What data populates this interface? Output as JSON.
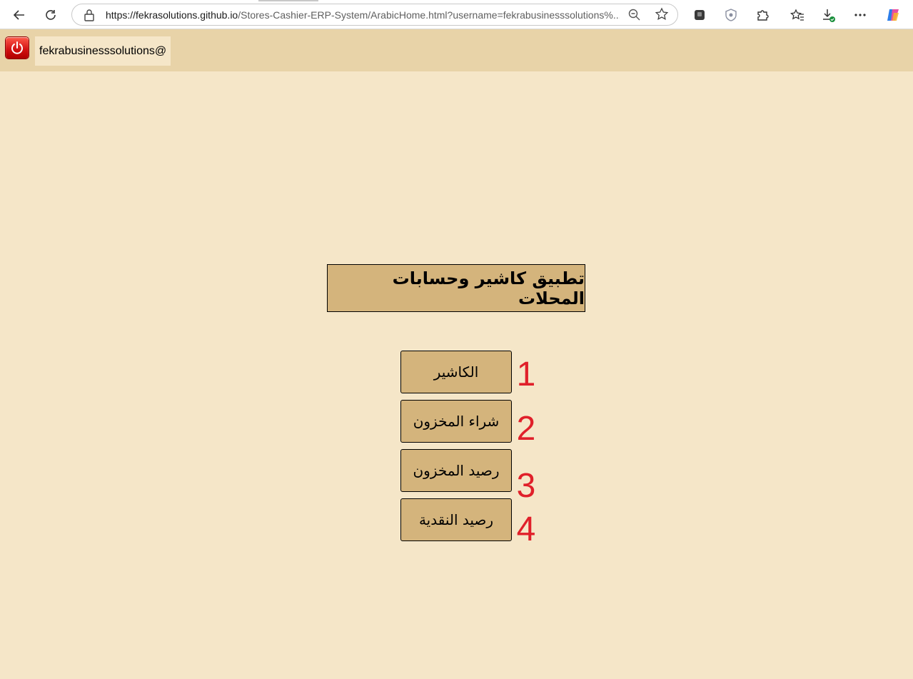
{
  "browser": {
    "url_host": "https://fekrasolutions.github.io",
    "url_path": "/Stores-Cashier-ERP-System/ArabicHome.html?username=fekrabusinesssolutions%...",
    "icons": [
      "back-icon",
      "refresh-icon",
      "lock-icon",
      "zoom-out-icon",
      "star-icon",
      "extension-icon",
      "shield-icon",
      "puzzle-icon",
      "favorites-icon",
      "download-icon",
      "more-icon",
      "copilot-icon"
    ]
  },
  "header": {
    "username": "fekrabusinesssolutions@",
    "power_icon": "power-icon"
  },
  "main": {
    "title": "تطبيق كاشير وحسابات المحلات",
    "buttons": [
      {
        "label": "الكاشير",
        "number": "1"
      },
      {
        "label": "شراء المخزون",
        "number": "2"
      },
      {
        "label": "رصيد المخزون",
        "number": "3"
      },
      {
        "label": "رصيد النقدية",
        "number": "4"
      }
    ]
  },
  "colors": {
    "page_bg": "#f5e6c8",
    "header_bg": "#e8d3a8",
    "button_bg": "#d4b47c",
    "number_color": "#e0202a"
  }
}
